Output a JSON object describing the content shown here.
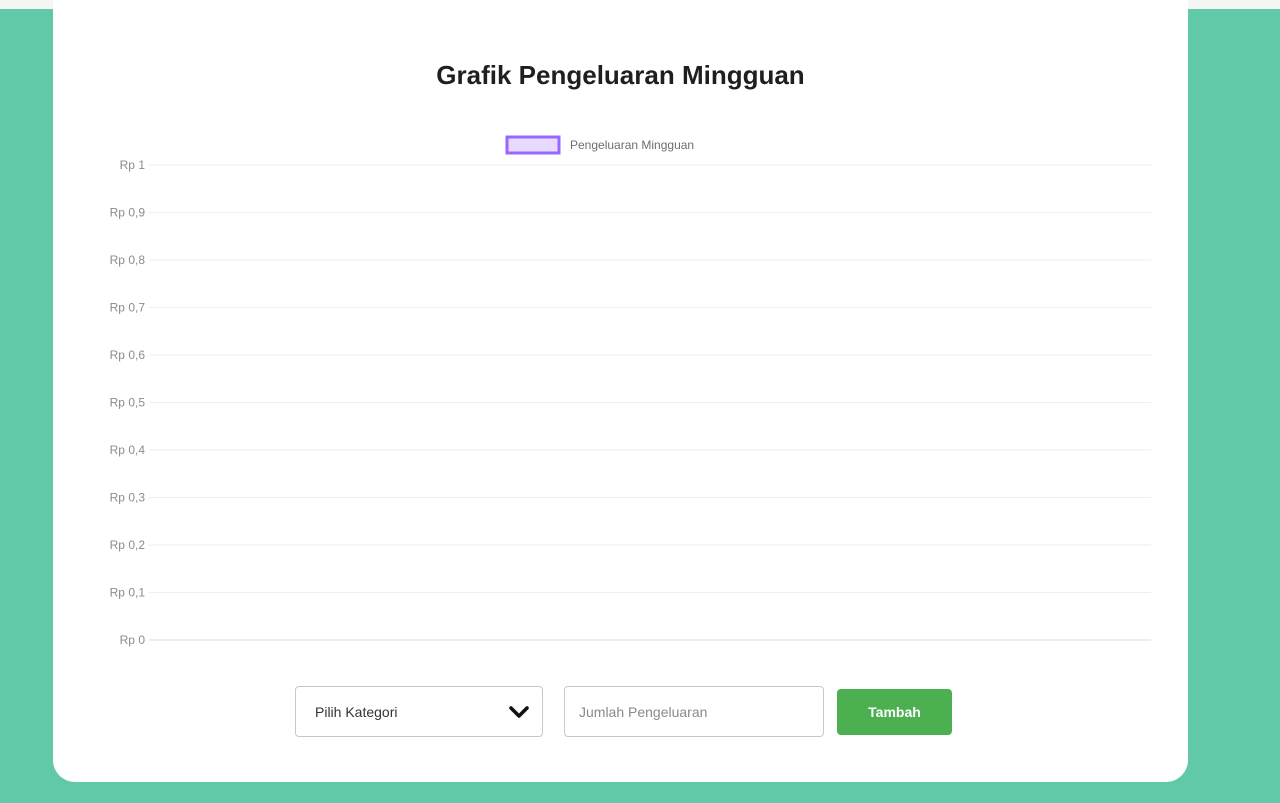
{
  "title": "Grafik Pengeluaran Mingguan",
  "chart_data": {
    "type": "bar",
    "title": "Grafik Pengeluaran Mingguan",
    "categories": [],
    "series": [
      {
        "name": "Pengeluaran Mingguan",
        "values": [],
        "color": "#9966ff"
      }
    ],
    "ylim": [
      0,
      1
    ],
    "yticks": [
      "Rp 0",
      "Rp 0,1",
      "Rp 0,2",
      "Rp 0,3",
      "Rp 0,4",
      "Rp 0,5",
      "Rp 0,6",
      "Rp 0,7",
      "Rp 0,8",
      "Rp 0,9",
      "Rp 1"
    ],
    "grid": true,
    "legend": "top-center"
  },
  "form": {
    "category_selected": "Pilih Kategori",
    "amount_placeholder": "Jumlah Pengeluaran",
    "add_label": "Tambah"
  },
  "colors": {
    "background": "#62c9a8",
    "card": "#ffffff",
    "button": "#4caf50",
    "legend_stroke": "#9966ff",
    "legend_fill": "#e6dbff"
  },
  "icons": {
    "select_arrow": "chevron-down-icon"
  }
}
